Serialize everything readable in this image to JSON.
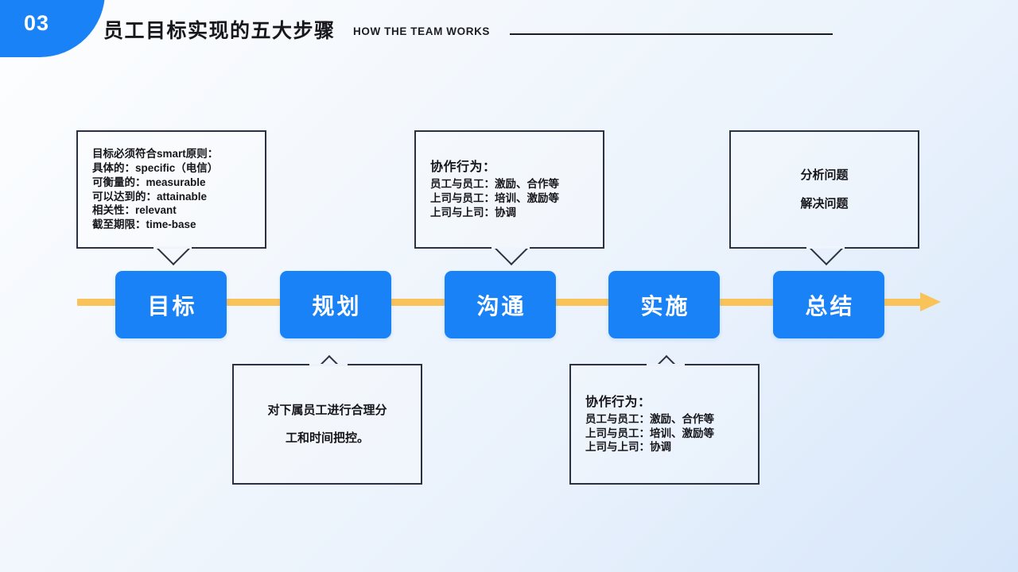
{
  "header": {
    "number": "03",
    "title": "员工目标实现的五大步骤",
    "subtitle": "HOW THE TEAM WORKS"
  },
  "colors": {
    "brand_blue": "#1a82f7",
    "flow_orange": "#f9c35a",
    "border_dark": "#2b3140",
    "text_dark": "#15151a",
    "step_text": "#ffffff"
  },
  "flow": {
    "steps": [
      {
        "label": "目标"
      },
      {
        "label": "规划"
      },
      {
        "label": "沟通"
      },
      {
        "label": "实施"
      },
      {
        "label": "总结"
      }
    ]
  },
  "callouts": [
    {
      "position": "above",
      "align": "left",
      "lines": [
        "目标必须符合smart原则：",
        "具体的：specific（电信）",
        "可衡量的：measurable",
        "可以达到的：attainable",
        "相关性：relevant",
        "截至期限：time-base"
      ]
    },
    {
      "position": "above",
      "align": "left",
      "heading": "协作行为：",
      "lines": [
        "员工与员工：激励、合作等",
        "上司与员工：培训、激励等",
        "上司与上司：协调"
      ]
    },
    {
      "position": "above",
      "align": "center",
      "lines": [
        "分析问题",
        "解决问题"
      ]
    },
    {
      "position": "below",
      "align": "center",
      "lines": [
        "对下属员工进行合理分",
        "工和时间把控。"
      ]
    },
    {
      "position": "below",
      "align": "left",
      "heading": "协作行为：",
      "lines": [
        "员工与员工：激励、合作等",
        "上司与员工：培训、激励等",
        "上司与上司：协调"
      ]
    }
  ]
}
